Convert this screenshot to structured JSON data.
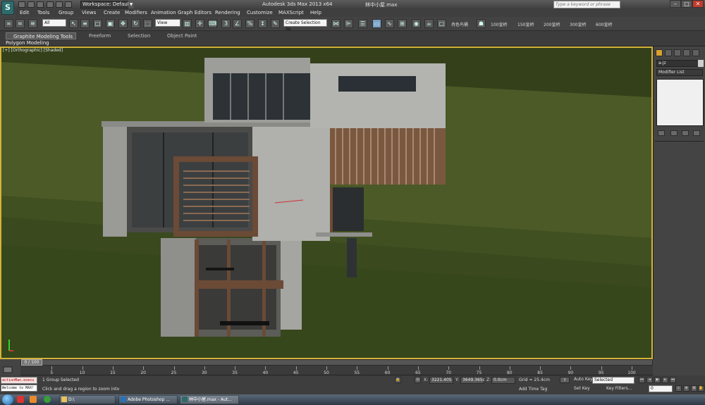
{
  "title_bar": {
    "workspace": "Workspace: Default",
    "app_title": "Autodesk 3ds Max  2013 x64",
    "file_name": "林中小屋.max",
    "help_search_placeholder": "Type a keyword or phrase",
    "window_buttons": [
      "–",
      "□",
      "✕"
    ]
  },
  "menu": [
    "Edit",
    "Tools",
    "Group",
    "Views",
    "Create",
    "Modifiers",
    "Animation",
    "Graph Editors",
    "Rendering",
    "Customize",
    "MAXScript",
    "Help"
  ],
  "toolbar": {
    "selection_filter": "All",
    "ref_coord": "View",
    "named_selection": "Create Selection Se",
    "grid_buttons": [
      "冉色鸟桶",
      "100皇桥",
      "150皇桥",
      "200皇桥",
      "300皇桥",
      "600皇桥"
    ]
  },
  "ribbon": {
    "tabs": [
      "Graphite Modeling Tools",
      "Freeform",
      "Selection",
      "Object Paint"
    ],
    "sub_label": "Polygon Modeling"
  },
  "viewport": {
    "label": "[+] [Orthographic] [Shaded]"
  },
  "command_panel": {
    "object_name": "a-jz",
    "modifier_list": "Modifier List"
  },
  "timeline": {
    "slider_label": "0 / 100",
    "ticks": [
      5,
      10,
      15,
      20,
      25,
      30,
      35,
      40,
      45,
      50,
      55,
      60,
      65,
      70,
      75,
      80,
      85,
      90,
      95,
      100
    ]
  },
  "status": {
    "maxscript_line1": "actionMan.execu",
    "maxscript_line2": "Welcome to MAX!",
    "selection": "1 Group Selected",
    "prompt": "Click and drag a region to zoom into",
    "x_label": "X:",
    "x_value": "3221.405",
    "y_label": "Y:",
    "y_value": "3649.365c",
    "z_label": "Z:",
    "z_value": "0.0cm",
    "grid": "Grid = 25.4cm",
    "time_tag": "Add Time Tag",
    "auto_key": "Auto Key",
    "key_mode": "Selected",
    "set_key": "Set Key",
    "key_filters": "Key Filters...",
    "frame": "0"
  },
  "taskbar": {
    "items": [
      "D:\\",
      "Adobe Photoshop ...",
      "林中小屋.max - Aut..."
    ]
  },
  "colors": {
    "viewport_border": "#d4b33a",
    "grass": "#3d4a1c",
    "concrete": "#a9a9a6",
    "wood": "#6b4a36"
  }
}
